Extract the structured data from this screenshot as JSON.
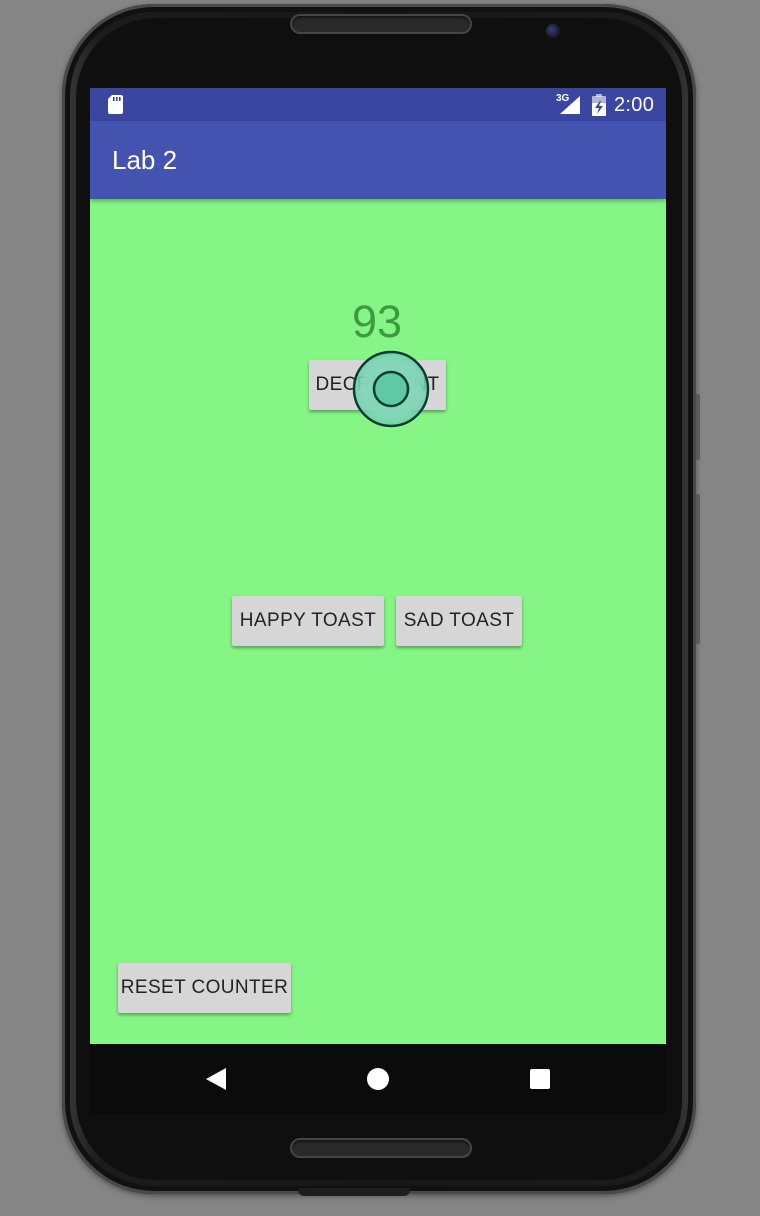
{
  "status_bar": {
    "network_type": "3G",
    "time": "2:00",
    "icons": [
      "sd-card-icon",
      "signal-icon",
      "battery-charging-icon"
    ]
  },
  "app_bar": {
    "title": "Lab 2"
  },
  "main": {
    "counter_value": "93",
    "decrement_label": "DECREMENT",
    "happy_toast_label": "HAPPY TOAST",
    "sad_toast_label": "SAD TOAST",
    "reset_label": "RESET COUNTER"
  },
  "nav_bar": {
    "icons": [
      "back-icon",
      "home-icon",
      "recents-icon"
    ]
  },
  "colors": {
    "background": "#85f585",
    "status_bar": "#3a46a0",
    "app_bar": "#4453b0",
    "counter_text": "#3f9a3f",
    "button": "#d6d6d6",
    "touch_indicator": "#5fc9a4"
  }
}
